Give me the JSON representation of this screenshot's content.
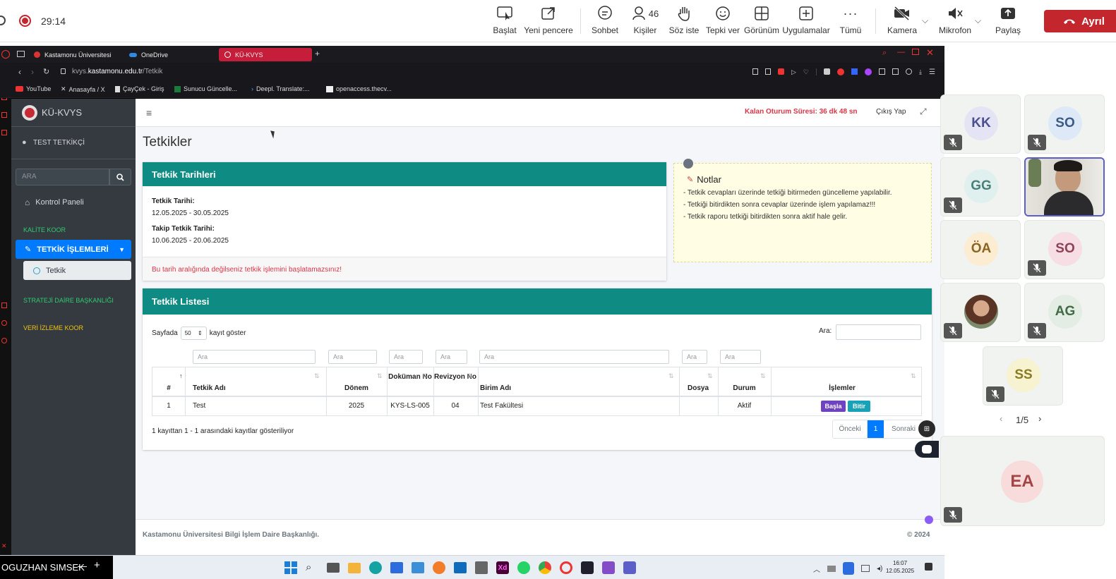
{
  "meeting": {
    "timer": "29:14",
    "buttons": {
      "start": "Başlat",
      "new_window": "Yeni pencere",
      "chat": "Sohbet",
      "people": "Kişiler",
      "people_count": "46",
      "raise_hand": "Söz iste",
      "react": "Tepki ver",
      "view": "Görünüm",
      "apps": "Uygulamalar",
      "more": "Tümü",
      "camera": "Kamera",
      "mic": "Mikrofon",
      "share": "Paylaş",
      "leave": "Ayrıl"
    },
    "presenter_name": "OGUZHAN SIMSEK",
    "participants": [
      {
        "initials": "KK",
        "bg": "#e4e4f4",
        "fg": "#4b4f8f"
      },
      {
        "initials": "SO",
        "bg": "#dde9f7",
        "fg": "#3b5b86"
      },
      {
        "initials": "GG",
        "bg": "#e0f0ef",
        "fg": "#4a7f7a"
      },
      {
        "initials": "",
        "video": true
      },
      {
        "initials": "ÖA",
        "bg": "#fbecd2",
        "fg": "#8a6420"
      },
      {
        "initials": "SO",
        "bg": "#f7dde4",
        "fg": "#8e4256"
      },
      {
        "initials": "",
        "photo": true
      },
      {
        "initials": "AG",
        "bg": "#e3ede3",
        "fg": "#3f6b46"
      },
      {
        "initials": "SS",
        "bg": "#f7f2cf",
        "fg": "#8a7b1f"
      }
    ],
    "pager": "1/5",
    "speaker": {
      "initials": "EA",
      "bg": "#f8dbdb",
      "fg": "#a54444"
    }
  },
  "browser": {
    "tabs": [
      {
        "label": "Kastamonu Üniversitesi"
      },
      {
        "label": "OneDrive"
      },
      {
        "label": "KÜ-KVYS"
      }
    ],
    "url_prefix": "kvys.",
    "url_domain": "kastamonu.edu.tr",
    "url_path": "/Tetkik",
    "bookmarks": [
      {
        "label": "YouTube"
      },
      {
        "label": "Anasayfa / X"
      },
      {
        "label": "ÇayÇek - Giriş"
      },
      {
        "label": "Sunucu Güncelle..."
      },
      {
        "label": "Deepl. Translate:..."
      },
      {
        "label": "openaccess.thecv..."
      }
    ]
  },
  "app": {
    "brand": "KÜ-KVYS",
    "user": "TEST TETKİKÇİ",
    "search_placeholder": "ARA",
    "menu": {
      "dashboard": "Kontrol Paneli",
      "section_quality": "KALİTE KOOR",
      "audit_ops": "TETKİK İŞLEMLERİ",
      "audit": "Tetkik",
      "section_strategy": "STRATEJİ DAİRE BAŞKANLIĞI",
      "section_monitoring": "VERİ İZLEME KOOR"
    },
    "session": "Kalan Oturum Süresi: 36 dk 48 sn",
    "logout": "Çıkış Yap",
    "page_title": "Tetkikler",
    "dates_card": {
      "title": "Tetkik Tarihleri",
      "audit_date_label": "Tetkik Tarihi:",
      "audit_date": "12.05.2025 - 30.05.2025",
      "followup_label": "Takip Tetkik Tarihi:",
      "followup_date": "10.06.2025 - 20.06.2025",
      "warning": "Bu tarih aralığında değilseniz tetkik işlemini başlatamazsınız!"
    },
    "notes": {
      "title": "Notlar",
      "lines": [
        "- Tetkik cevapları üzerinde tetkiği bitirmeden güncelleme yapılabilir.",
        "- Tetkiği bitirdikten sonra cevaplar üzerinde işlem yapılamaz!!!",
        "- Tetkik raporu tetkiği bitirdikten sonra aktif hale gelir."
      ]
    },
    "list": {
      "title": "Tetkik Listesi",
      "show_prefix": "Sayfada",
      "page_size": "50",
      "show_suffix": "kayıt göster",
      "search_label": "Ara:",
      "filter_placeholder": "Ara",
      "columns": [
        "#",
        "Tetkik Adı",
        "Dönem",
        "Doküman No",
        "Revizyon No",
        "Birim Adı",
        "Dosya",
        "Durum",
        "İşlemler"
      ],
      "rows": [
        {
          "no": "1",
          "name": "Test",
          "period": "2025",
          "doc": "KYS-LS-005",
          "rev": "04",
          "unit": "Test Fakültesi",
          "file": "",
          "status": "Aktif",
          "start": "Başla",
          "finish": "Bitir"
        }
      ],
      "info": "1 kayıttan 1 - 1 arasındaki kayıtlar gösteriliyor",
      "prev": "Önceki",
      "page": "1",
      "next": "Sonraki"
    },
    "footer": "Kastamonu Üniversitesi Bilgi İşlem Daire Başkanlığı.",
    "copyright": "© 2024"
  },
  "taskbar": {
    "time": "16:07",
    "date": "12.05.2025"
  }
}
